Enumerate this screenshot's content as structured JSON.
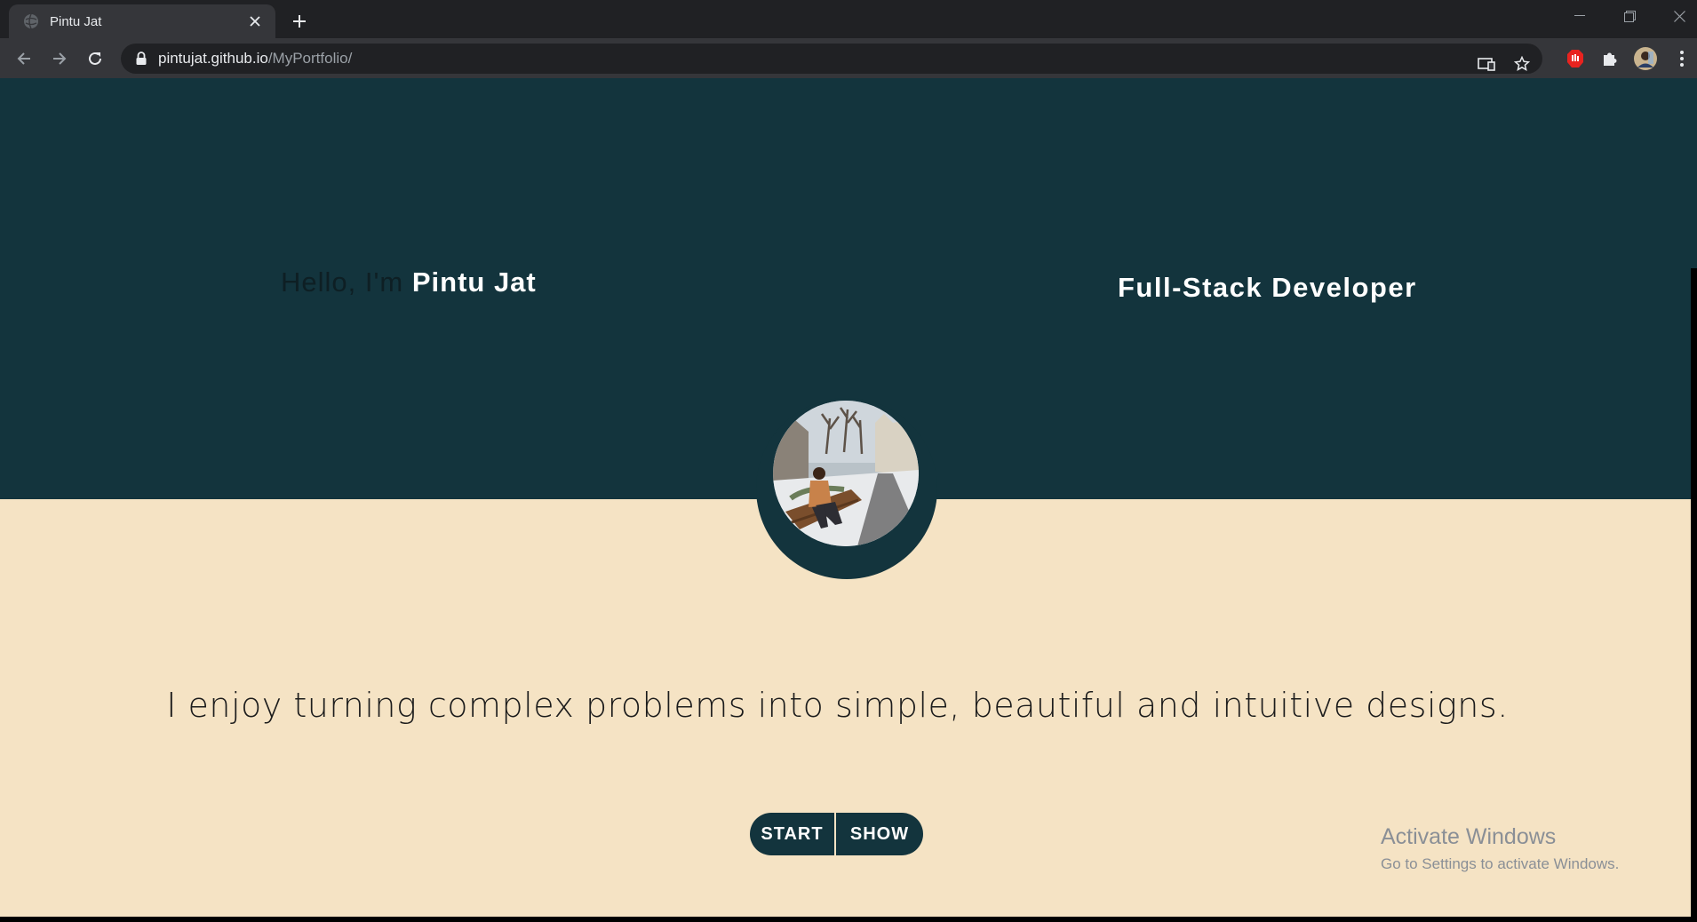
{
  "browser": {
    "tab_title": "Pintu Jat",
    "url_host": "pintujat.github.io",
    "url_path": "/MyPortfolio/"
  },
  "hero": {
    "greeting_prefix": "Hello, I'm ",
    "name": "Pintu Jat",
    "role": "Full-Stack Developer"
  },
  "about": {
    "tagline": "I enjoy turning complex problems into simple, beautiful and intuitive designs."
  },
  "buttons": {
    "start": "START",
    "show": "SHOW"
  },
  "watermark": {
    "title": "Activate Windows",
    "subtitle": "Go to Settings to activate Windows."
  },
  "colors": {
    "hero_bg": "#13343d",
    "lower_bg": "#f5e3c4",
    "button_bg": "#13343d"
  }
}
